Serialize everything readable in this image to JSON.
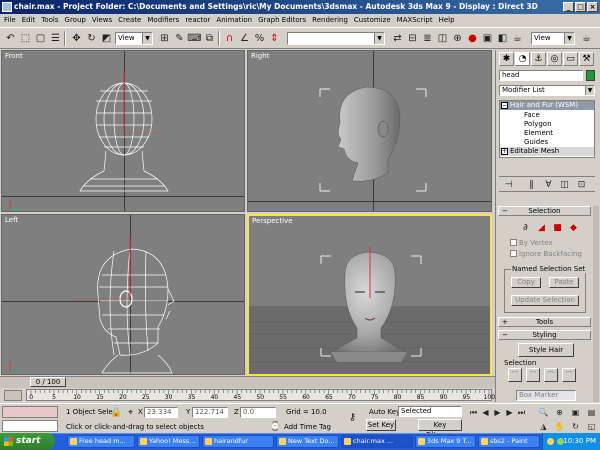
{
  "window": {
    "title": "chair.max  - Project Folder: C:\\Documents and Settings\\ric\\My Documents\\3dsmax   - Autodesk 3ds Max 9   - Display : Direct 3D",
    "minimize": "_",
    "maximize": "□",
    "close": "×"
  },
  "menu": [
    "File",
    "Edit",
    "Tools",
    "Group",
    "Views",
    "Create",
    "Modifiers",
    "reactor",
    "Animation",
    "Graph Editors",
    "Rendering",
    "Customize",
    "MAXScript",
    "Help"
  ],
  "toolbar": {
    "view_dropdown_1": "View",
    "named_selection": "",
    "view_dropdown_2": "View"
  },
  "viewports": {
    "front": "Front",
    "right": "Right",
    "left": "Left",
    "perspective": "Perspective"
  },
  "command_panel": {
    "object_name": "head",
    "object_color": "#1f9a32",
    "modifier_list": "Modifier List",
    "stack": {
      "hair_and_fur": "Hair and Fur (WSM)",
      "face": "Face",
      "polygon": "Polygon",
      "element": "Element",
      "guides": "Guides",
      "editable_mesh": "Editable Mesh"
    },
    "selection": {
      "header": "Selection",
      "by_vertex": "By Vertex",
      "ignore_backfacing": "Ignore Backfacing",
      "named_selection_set": "Named Selection Set",
      "copy": "Copy",
      "paste": "Paste",
      "update_selection": "Update Selection"
    },
    "tools_header": "Tools",
    "styling": {
      "header": "Styling",
      "style_hair": "Style Hair",
      "selection_label": "Selection",
      "box_marker": "Box Marker"
    }
  },
  "timeline": {
    "frame_readout": "0 / 100",
    "ticks": [
      "0",
      "5",
      "10",
      "15",
      "20",
      "25",
      "30",
      "35",
      "40",
      "45",
      "50",
      "55",
      "60",
      "65",
      "70",
      "75",
      "80",
      "85",
      "90",
      "95",
      "100"
    ]
  },
  "status": {
    "objects_selected": "1 Object Sele",
    "x_label": "X",
    "x_value": "23.334",
    "y_label": "Y",
    "y_value": "122.714",
    "z_label": "Z",
    "z_value": "0.0",
    "grid": "Grid = 10.0",
    "add_time_tag": "Add Time Tag",
    "prompt": "Click or click-and-drag to select objects",
    "auto_key": "Auto Key",
    "set_key": "Set Key",
    "key_mode": "Selected",
    "key_filters": "Key Filters..."
  },
  "taskbar": {
    "start": "start",
    "tasks": [
      "Free head m...",
      "Yahoo! Mess...",
      "hairandfur",
      "New Text Do...",
      "chair.max ...",
      "3ds Max 9 T...",
      "sbs2 - Paint"
    ],
    "clock": "10:30 PM"
  },
  "colors": {
    "titlebar": "#0a246a",
    "viewport_bg": "#7f7f7f",
    "active_viewport_border": "#f2e64a",
    "perspective_floor": "#6b6b6b"
  }
}
